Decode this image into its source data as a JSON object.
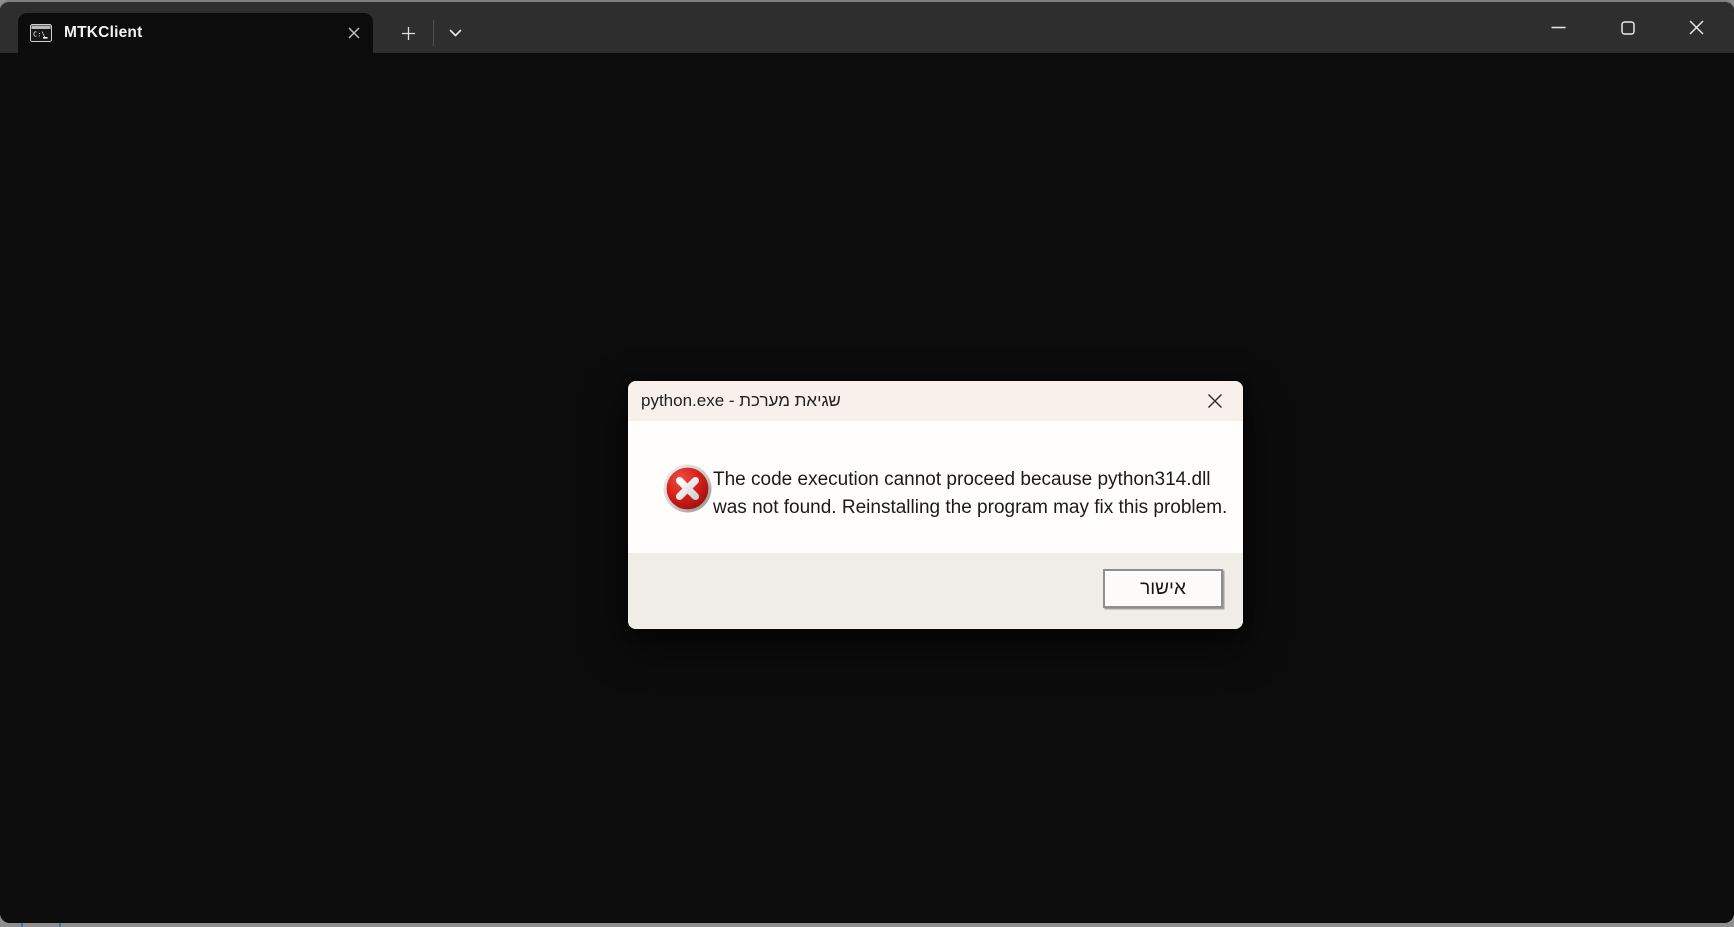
{
  "colors": {
    "terminal_bg": "#0c0c0c",
    "tab_bar_bg": "#2e2e2e",
    "window_top_border": "#7e7e7e",
    "desktop_behind": "#8e8e8e",
    "dialog_titlebar_bg": "#f8f0ea",
    "dialog_body_bg": "#fffefc",
    "dialog_footer_bg": "#f0ece8",
    "error_red": "#c41616"
  },
  "titlebar": {
    "tab": {
      "icon": "cmd-terminal-icon",
      "title": "MTKClient",
      "close_icon": "close-icon"
    },
    "new_tab_icon": "plus-icon",
    "dropdown_icon": "chevron-down-icon",
    "window_controls": {
      "minimize_icon": "minimize-icon",
      "maximize_icon": "maximize-icon",
      "close_icon": "close-icon"
    }
  },
  "dialog": {
    "title": "python.exe - שגיאת מערכת",
    "close_icon": "close-icon",
    "error_icon": "error-icon",
    "message": {
      "line1": "The code execution cannot proceed because python314.dll",
      "line2": "was not found. Reinstalling the program may fix this problem."
    },
    "ok_button_label": "אישור"
  }
}
